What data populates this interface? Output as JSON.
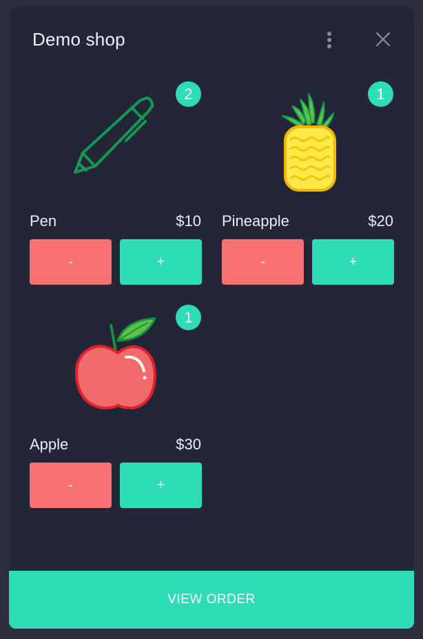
{
  "header": {
    "title": "Demo shop",
    "menu_icon": "more-vertical-icon",
    "close_icon": "close-icon"
  },
  "products": [
    {
      "name": "Pen",
      "price": "$10",
      "count": "2",
      "icon": "pen-icon",
      "minus_label": "-",
      "plus_label": "+"
    },
    {
      "name": "Pineapple",
      "price": "$20",
      "count": "1",
      "icon": "pineapple-icon",
      "minus_label": "-",
      "plus_label": "+"
    },
    {
      "name": "Apple",
      "price": "$30",
      "count": "1",
      "icon": "apple-icon",
      "minus_label": "-",
      "plus_label": "+"
    }
  ],
  "footer": {
    "view_order_label": "VIEW ORDER"
  },
  "colors": {
    "accent": "#2edcb7",
    "remove": "#f87171",
    "panel": "#222636",
    "background": "#2b2e3b"
  }
}
